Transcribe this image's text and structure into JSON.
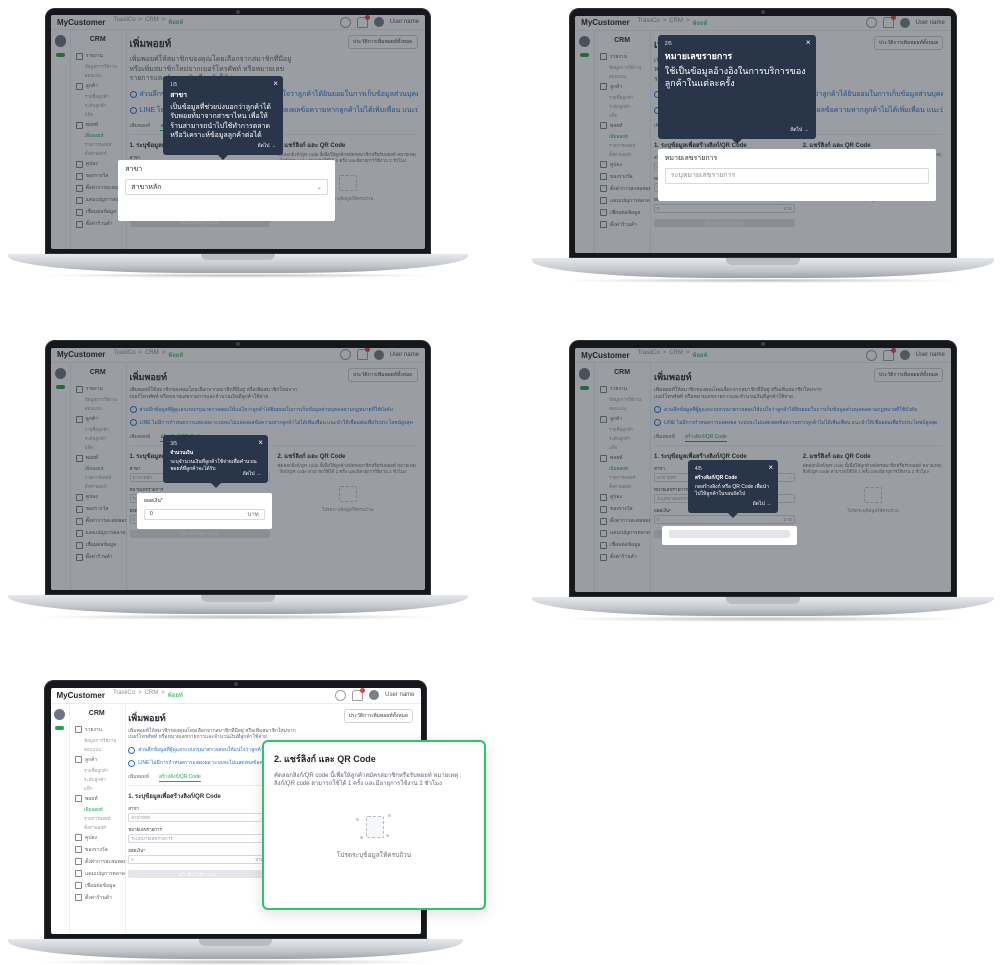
{
  "app": {
    "logo": "MyCustomer",
    "crumb": [
      "TrasiiCo",
      "CRM",
      "พ้อยท์"
    ],
    "user": "User name"
  },
  "sidebar": {
    "title": "CRM",
    "items": [
      {
        "label": "รายงาน",
        "subs": [
          "ข้อมูลการใช้งาน",
          "ตอบแบบ"
        ]
      },
      {
        "label": "ลูกค้า",
        "subs": [
          "รายชื่อลูกค้า",
          "ระดับลูกค้า",
          "แท็ก"
        ]
      },
      {
        "label": "พอยท์",
        "subs": [
          "เพิ่มพอยท์",
          "รายการพอยท์",
          "ตั้งค่าพอยท์"
        ]
      },
      {
        "label": "คูปอง",
        "subs": []
      },
      {
        "label": "ของรางวัล",
        "subs": []
      },
      {
        "label": "ตั้งค่าการสะสมพอยท์และรางวัล",
        "subs": []
      },
      {
        "label": "แคมเปญการตลาด",
        "subs": []
      },
      {
        "label": "เชื่อมต่อข้อมูล",
        "subs": []
      },
      {
        "label": "ตั้งค่าร้านค้า",
        "subs": []
      }
    ]
  },
  "main": {
    "title": "เพิ่มพอยท์",
    "desc": "เพิ่มพอยท์ให้สมาชิกของคุณโดยเลือกจากสมาชิกที่มีอยู่ หรือเพิ่มสมาชิกใหม่จากเบอร์โทรศัพท์ หรือหมายเลขรายการและจำนวนเงินที่ลูกค้าใช้จ่าย",
    "history_button": "ประวัติการเพิ่มพอยท์ทั้งหมด",
    "notice_1": "ส่วนลึกข้อมูลที่ผู้ดูแลระบบกรุณาตรวจสอบให้แน่ใจว่าลูกค้าได้ยินยอมในการเก็บข้อมูลส่วนบุคคลตามกฎหมายที่ใช้บังคับ",
    "notice_2": "LINE ไม่มีการกำหนดการแสดงผล ระบบจะไม่แสดงผลข้อความหากลูกค้าไม่ได้เพิ่มเพื่อน แนะนำให้เชื่อมต่อเพื่อรับประโยชน์สูงสุด",
    "tab_1": "เพิ่มพอยท์",
    "tab_2": "สร้างลิงก์/QR Code",
    "col1_title": "1. ระบุข้อมูลเพื่อสร้างลิงก์/QR Code",
    "col2_title": "2. แชร์ลิงก์ และ QR Code",
    "col2_desc": "คัดลอกลิงก์/QR code นี้เพื่อให้ลูกค้าสมัครสมาชิกหรือรับพอยท์ หมายเหตุ : ลิงก์/QR code สามารถใช้ได้ 1 ครั้ง และมีอายุการใช้งาน 2 ชั่วโมง",
    "branch_label": "สาขา",
    "branch_value": "สาขาหลัก",
    "order_label": "หมายเลขรายการ",
    "order_placeholder": "ระบุหมายเลขรายการ",
    "amount_label": "ยอดเงิน*",
    "amount_value": "0",
    "amount_unit": "บาท",
    "submit": "สร้างลิงก์/QR Code",
    "empty": "โปรดระบุข้อมูลให้ครบถ้วน"
  },
  "tips": [
    {
      "step": "1/5",
      "title": "สาขา",
      "body": "เป็นข้อมูลที่ช่วยบ่งบอกว่าลูกค้าได้รับพอยท์มาจากสาขาไหน เพื่อให้ร้านสามารถนำไปใช้ทำการตลาดหรือวิเคราะห์ข้อมูลลูกค้าต่อได้",
      "next": "ถัดไป →"
    },
    {
      "step": "2/5",
      "title": "หมายเลขรายการ",
      "body": "ใช้เป็นข้อมูลอ้างอิงในการบริการของลูกค้าในแต่ละครั้ง",
      "next": "ถัดไป →"
    },
    {
      "step": "3/5",
      "title": "จำนวนเงิน",
      "body": "ระบุจำนวนเงินที่ลูกค้าใช้จ่ายเพื่อคำนวณพอยท์ที่ลูกค้าจะได้รับ",
      "next": "ถัดไป →"
    },
    {
      "step": "4/5",
      "title": "สร้างลิงก์/QR Code",
      "body": "กดสร้างลิงก์ หรือ QR Code เพื่อนำไปให้ลูกค้าในรอบถัดไป",
      "next": "ถัดไป →"
    }
  ],
  "popout": {
    "title": "2. แชร์ลิงก์ และ QR Code",
    "desc": "คัดลอกลิงก์/QR code นี้เพื่อให้ลูกค้าสมัครสมาชิกหรือรับพอยท์ หมายเหตุ : ลิงก์/QR code สามารถใช้ได้ 1 ครั้ง และมีอายุการใช้งาน 2 ชั่วโมง",
    "empty": "โปรดระบุข้อมูลให้ครบถ้วน"
  },
  "colors": {
    "accent": "#23a455",
    "tooltip": "#29364a",
    "popout_border": "#2ec46a"
  }
}
